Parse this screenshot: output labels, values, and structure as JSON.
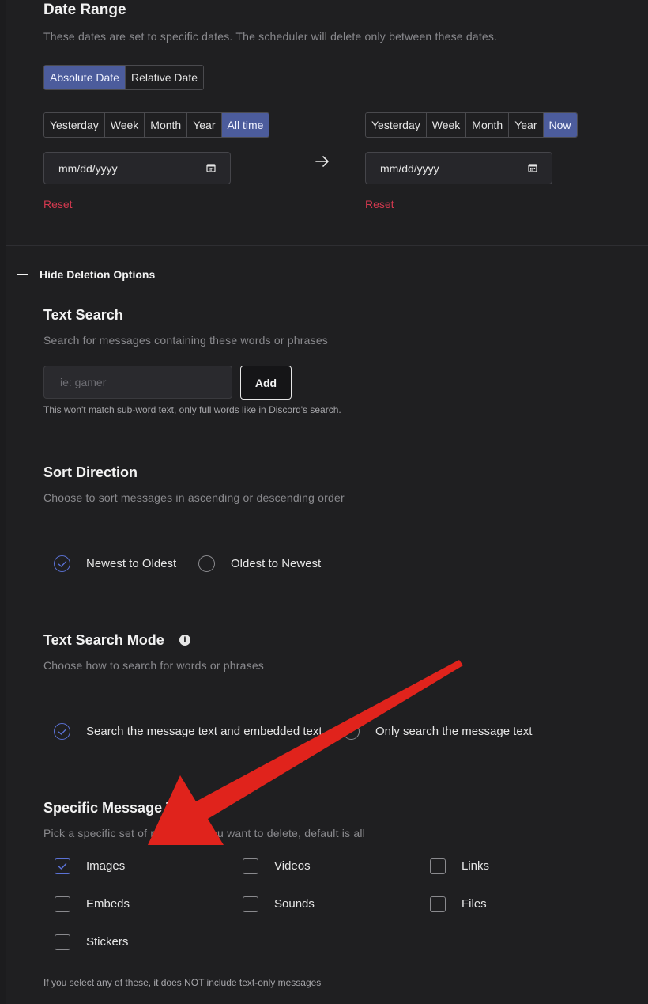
{
  "date_range": {
    "title": "Date Range",
    "description": "These dates are set to specific dates. The scheduler will delete only between these dates.",
    "mode_tabs": [
      {
        "label": "Absolute Date",
        "active": true
      },
      {
        "label": "Relative Date",
        "active": false
      }
    ],
    "from": {
      "presets": [
        {
          "label": "Yesterday",
          "active": false
        },
        {
          "label": "Week",
          "active": false
        },
        {
          "label": "Month",
          "active": false
        },
        {
          "label": "Year",
          "active": false
        },
        {
          "label": "All time",
          "active": true
        }
      ],
      "date_value": "mm/dd/yyyy",
      "reset_label": "Reset"
    },
    "to": {
      "presets": [
        {
          "label": "Yesterday",
          "active": false
        },
        {
          "label": "Week",
          "active": false
        },
        {
          "label": "Month",
          "active": false
        },
        {
          "label": "Year",
          "active": false
        },
        {
          "label": "Now",
          "active": true
        }
      ],
      "date_value": "mm/dd/yyyy",
      "reset_label": "Reset"
    },
    "arrow_icon": "arrow-right-icon"
  },
  "deletion_options": {
    "toggle_label": "Hide Deletion Options",
    "toggle_icon": "minus-icon"
  },
  "text_search": {
    "title": "Text Search",
    "description": "Search for messages containing these words or phrases",
    "placeholder": "ie: gamer",
    "value": "",
    "add_label": "Add",
    "hint": "This won't match sub-word text, only full words like in Discord's search."
  },
  "sort_direction": {
    "title": "Sort Direction",
    "description": "Choose to sort messages in ascending or descending order",
    "options": [
      {
        "label": "Newest to Oldest",
        "checked": true
      },
      {
        "label": "Oldest to Newest",
        "checked": false
      }
    ]
  },
  "text_search_mode": {
    "title": "Text Search Mode",
    "description": "Choose how to search for words or phrases",
    "info_icon": "info-icon",
    "options": [
      {
        "label": "Search the message text and embedded text",
        "checked": true
      },
      {
        "label": "Only search the message text",
        "checked": false
      }
    ]
  },
  "message_types": {
    "title": "Specific Message Types",
    "description": "Pick a specific set of messages you want to delete, default is all",
    "types": [
      {
        "label": "Images",
        "checked": true
      },
      {
        "label": "Videos",
        "checked": false
      },
      {
        "label": "Links",
        "checked": false
      },
      {
        "label": "Embeds",
        "checked": false
      },
      {
        "label": "Sounds",
        "checked": false
      },
      {
        "label": "Files",
        "checked": false
      },
      {
        "label": "Stickers",
        "checked": false
      }
    ],
    "footnote": "If you select any of these, it does NOT include text-only messages"
  },
  "colors": {
    "background": "#1f1f21",
    "accent": "#4c5c9c",
    "check": "#5b72d6",
    "reset": "#d3394f",
    "annotation_arrow": "#e0231c"
  }
}
